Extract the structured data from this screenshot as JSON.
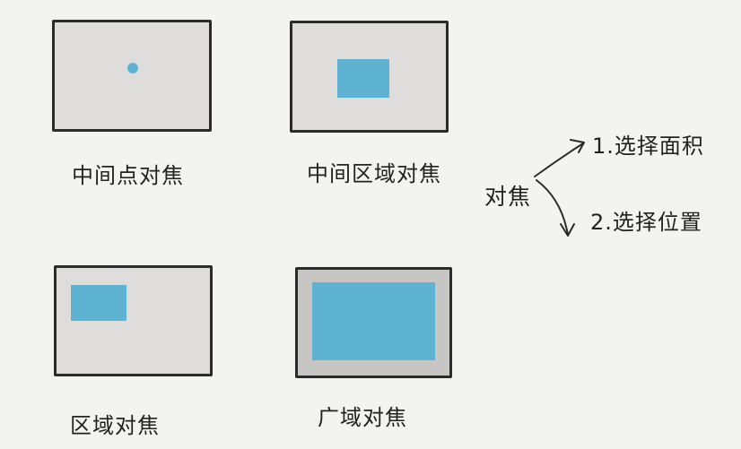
{
  "colors": {
    "frame_fill": "#dedddb",
    "frame_fill_wide": "#c7c6c4",
    "highlight": "#5fb3d2"
  },
  "panels": [
    {
      "label": "中间点对焦"
    },
    {
      "label": "中间区域对焦"
    },
    {
      "label": "区域对焦"
    },
    {
      "label": "广域对焦"
    }
  ],
  "focus_branch": {
    "center": "对焦",
    "option_1": "1.选择面积",
    "option_2": "2.选择位置"
  }
}
